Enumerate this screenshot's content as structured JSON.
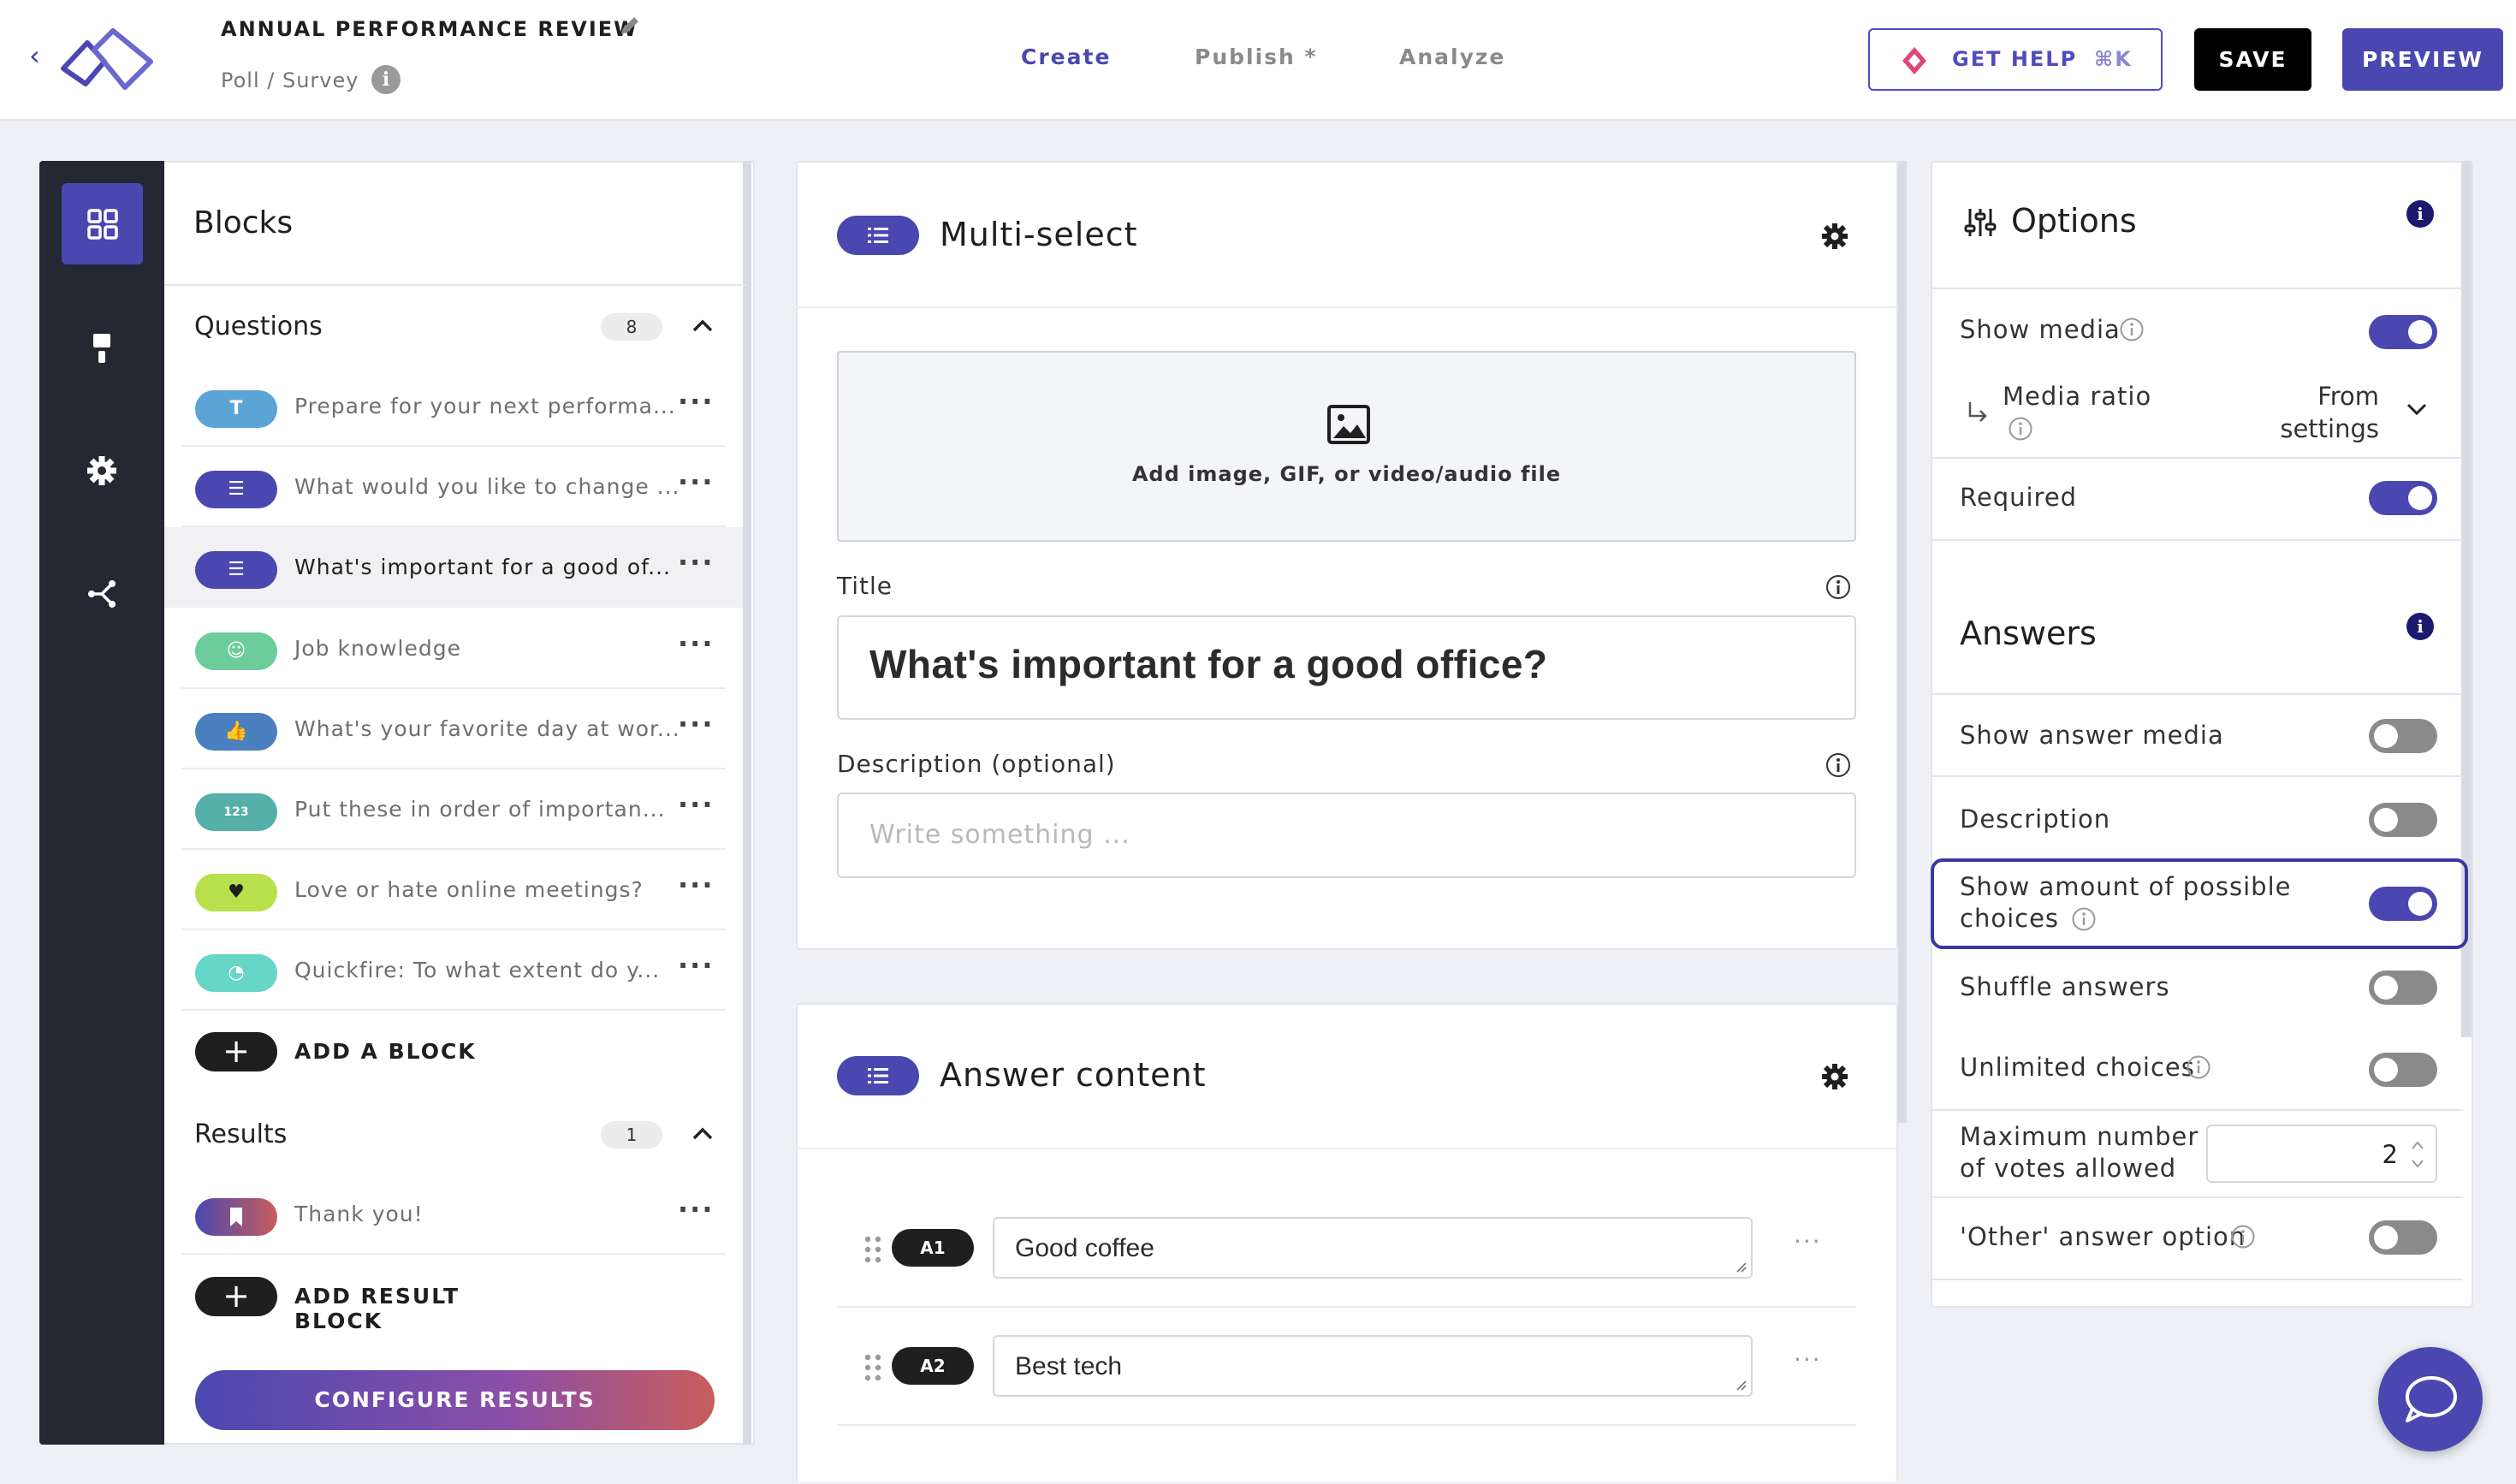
{
  "header": {
    "title": "ANNUAL PERFORMANCE REVIEW",
    "subtitle": "Poll / Survey",
    "tabs": [
      {
        "label": "Create"
      },
      {
        "label": "Publish *"
      },
      {
        "label": "Analyze"
      }
    ],
    "help_label": "GET HELP",
    "help_shortcut": "⌘K",
    "save_label": "SAVE",
    "preview_label": "PREVIEW"
  },
  "sidebar": {
    "icons": [
      "blocks-grid-icon",
      "paint-brush-icon",
      "gear-icon",
      "share-flow-icon"
    ]
  },
  "blocks_panel": {
    "title": "Blocks",
    "questions": {
      "title": "Questions",
      "count": "8",
      "items": [
        {
          "icon_text": "T",
          "label": "Prepare for your next performa...",
          "color": "#5aa5d6"
        },
        {
          "icon_text": "☰",
          "label": "What would you like to change ...",
          "color": "#4a48b0"
        },
        {
          "icon_text": "☰",
          "label": "What's important for a good of...",
          "color": "#4a48b0"
        },
        {
          "icon_text": "☺",
          "label": "Job knowledge",
          "color": "#6ccc9c"
        },
        {
          "icon_text": "👍",
          "label": "What's your favorite day at wor...",
          "color": "#4a7fc0"
        },
        {
          "icon_text": "123",
          "label": "Put these in order of importan...",
          "color": "#54b0a8"
        },
        {
          "icon_text": "♥",
          "label": "Love or hate online meetings?",
          "color": "#b7e04a"
        },
        {
          "icon_text": "◔",
          "label": "Quickfire: To what extent do y...",
          "color": "#66d6c6"
        }
      ],
      "add_label": "ADD A BLOCK"
    },
    "results": {
      "title": "Results",
      "count": "1",
      "items": [
        {
          "label": "Thank you!"
        }
      ],
      "add_label": "ADD RESULT BLOCK"
    },
    "configure_label": "CONFIGURE RESULTS"
  },
  "editor": {
    "block_type": "Multi-select",
    "media_label": "Add image, GIF, or video/audio file",
    "title_label": "Title",
    "title_value": "What's important for a good office?",
    "description_label": "Description (optional)",
    "description_placeholder": "Write something ...",
    "answer_section_title": "Answer content",
    "answers": [
      {
        "tag": "A1",
        "value": "Good coffee"
      },
      {
        "tag": "A2",
        "value": "Best tech"
      }
    ]
  },
  "options": {
    "title": "Options",
    "show_media": {
      "label": "Show media",
      "on": true
    },
    "media_ratio": {
      "label": "Media ratio",
      "value_line1": "From",
      "value_line2": "settings"
    },
    "required": {
      "label": "Required",
      "on": true
    },
    "answers_title": "Answers",
    "show_answer_media": {
      "label": "Show answer media",
      "on": false
    },
    "description": {
      "label": "Description",
      "on": false
    },
    "show_amount": {
      "label_line1": "Show amount of possible",
      "label_line2": "choices",
      "on": true
    },
    "shuffle": {
      "label": "Shuffle answers",
      "on": false
    },
    "unlimited": {
      "label": "Unlimited choices",
      "on": false
    },
    "max_votes": {
      "label_line1": "Maximum number",
      "label_line2": "of votes allowed",
      "value": "2"
    },
    "other_option": {
      "label": "'Other' answer option",
      "on": false
    }
  },
  "colors": {
    "accent": "#4a48b0",
    "rail": "#252833"
  }
}
